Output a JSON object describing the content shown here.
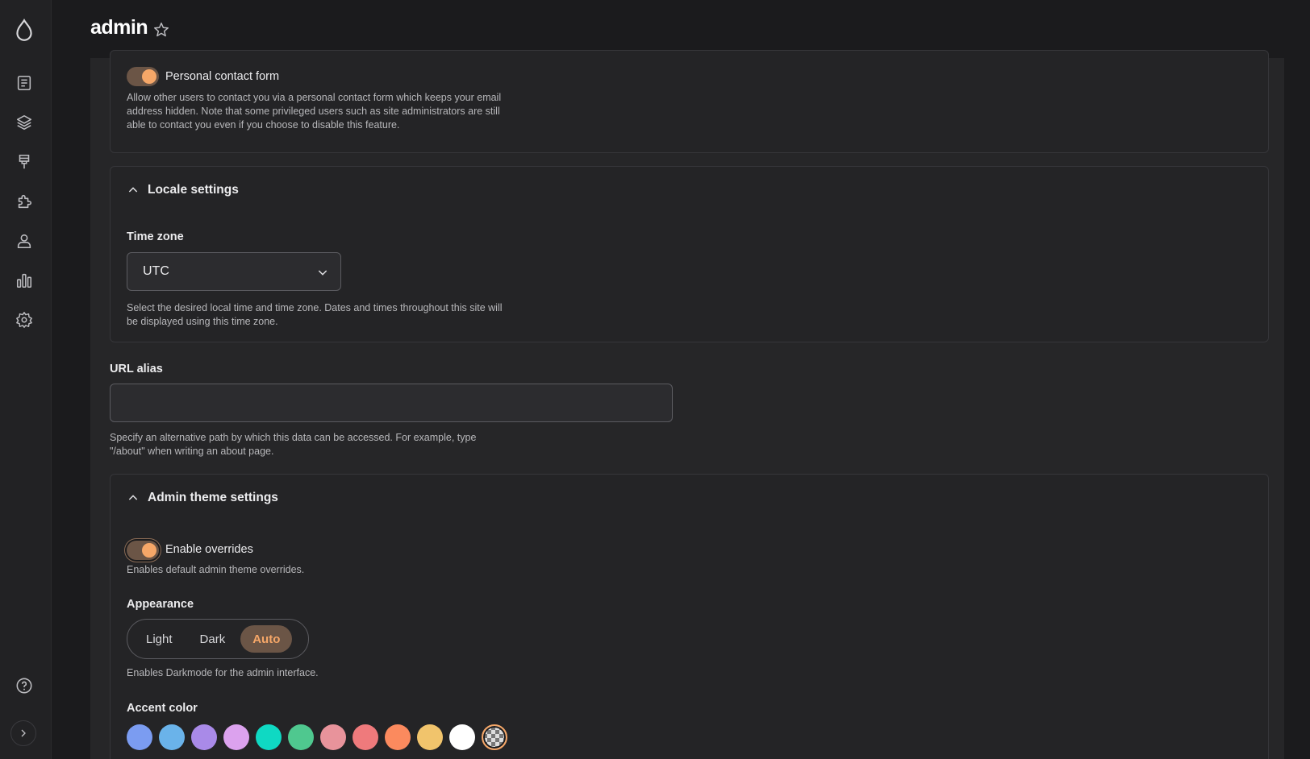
{
  "header": {
    "title": "admin"
  },
  "sidebar": {
    "items": [
      "content-icon",
      "structure-icon",
      "appearance-icon",
      "extend-icon",
      "people-icon",
      "reports-icon",
      "configuration-icon"
    ],
    "bottom": [
      "help-icon",
      "expand-icon"
    ]
  },
  "contact": {
    "toggle_label": "Personal contact form",
    "toggle_on": true,
    "description_line1": "Allow other users to contact you via a personal contact form which keeps your email",
    "description_line2": "address hidden. Note that some privileged users such as site administrators are still",
    "description_line3": "able to contact you even if you choose to disable this feature."
  },
  "locale": {
    "heading": "Locale settings",
    "timezone_label": "Time zone",
    "timezone_value": "UTC",
    "description_line1": "Select the desired local time and time zone. Dates and times throughout this site will",
    "description_line2": "be displayed using this time zone."
  },
  "url_alias": {
    "label": "URL alias",
    "value": "",
    "description_line1": "Specify an alternative path by which this data can be accessed. For example, type",
    "description_line2": "\"/about\" when writing an about page."
  },
  "admin_theme": {
    "heading": "Admin theme settings",
    "overrides_label": "Enable overrides",
    "overrides_on": true,
    "overrides_description": "Enables default admin theme overrides.",
    "appearance_label": "Appearance",
    "appearance_options": [
      "Light",
      "Dark",
      "Auto"
    ],
    "appearance_selected": "Auto",
    "appearance_description": "Enables Darkmode for the admin interface.",
    "accent_label": "Accent color",
    "accent_colors": [
      "#7b9cf1",
      "#6ab3ea",
      "#a98ae8",
      "#dca2ee",
      "#0fd9c3",
      "#4fc88f",
      "#e8939b",
      "#ef7a7c",
      "#fb8a5e",
      "#f1c46c",
      "#ffffff",
      "custom"
    ]
  },
  "colors": {
    "accent": "#f6a768",
    "accent_bg": "#6b5546",
    "page_bg": "#1b1b1d"
  }
}
